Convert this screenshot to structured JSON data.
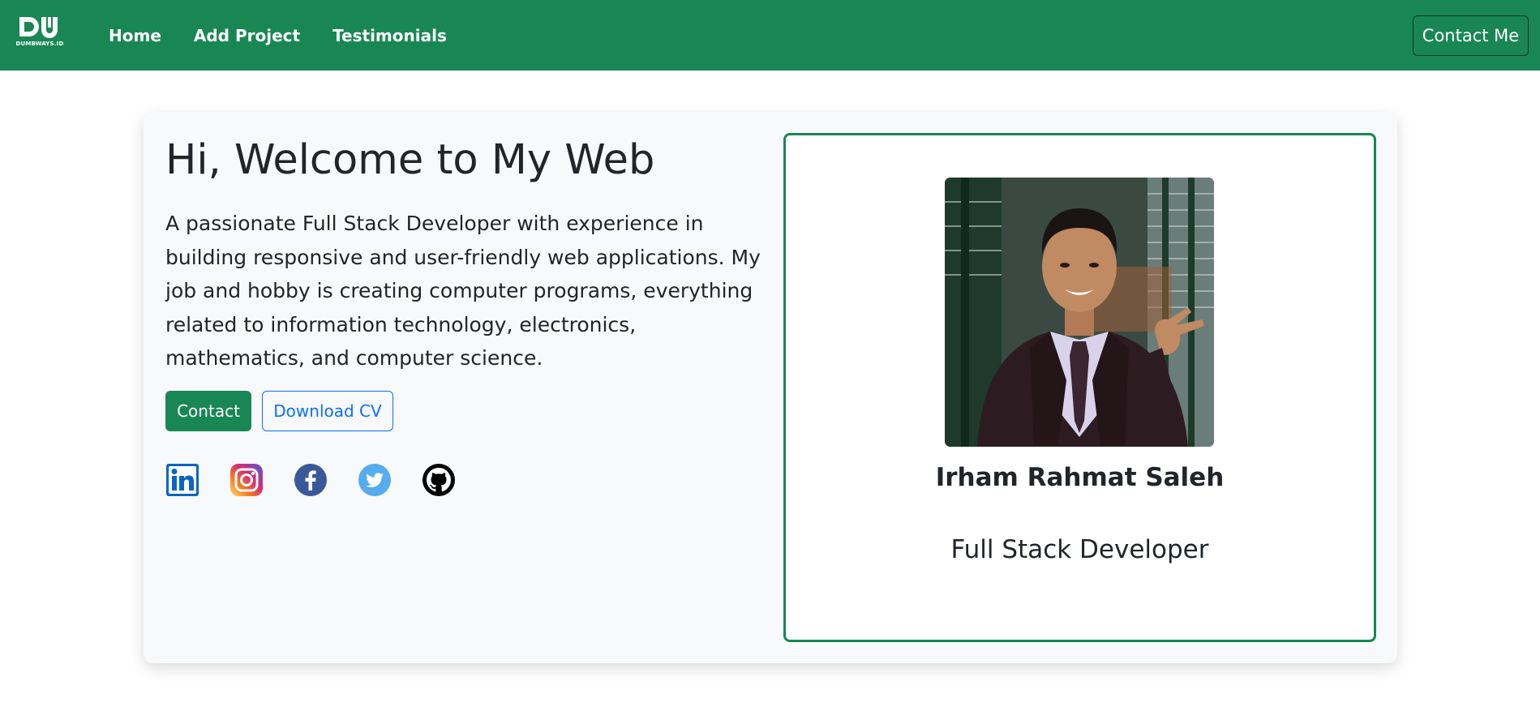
{
  "brand": {
    "logo_text": "DUMBWAYS.ID",
    "icon": "dumbways-logo"
  },
  "nav": {
    "links": [
      {
        "label": "Home"
      },
      {
        "label": "Add Project"
      },
      {
        "label": "Testimonials"
      }
    ],
    "contact_button": "Contact Me"
  },
  "hero": {
    "title": "Hi, Welcome to My Web",
    "description": "A passionate Full Stack Developer with experience in building responsive and user-friendly web applications. My job and hobby is creating computer programs, everything related to information technology, electronics, mathematics, and computer science.",
    "contact_button": "Contact",
    "cv_button": "Download CV",
    "socials": [
      {
        "icon": "linkedin-icon"
      },
      {
        "icon": "instagram-icon"
      },
      {
        "icon": "facebook-icon"
      },
      {
        "icon": "twitter-icon"
      },
      {
        "icon": "github-icon"
      }
    ]
  },
  "profile": {
    "name": "Irham Rahmat Saleh",
    "role": "Full Stack Developer",
    "photo": "profile-photo"
  },
  "colors": {
    "primary": "#198754",
    "link": "#0d6efd",
    "card_bg": "#f8f9fa"
  }
}
